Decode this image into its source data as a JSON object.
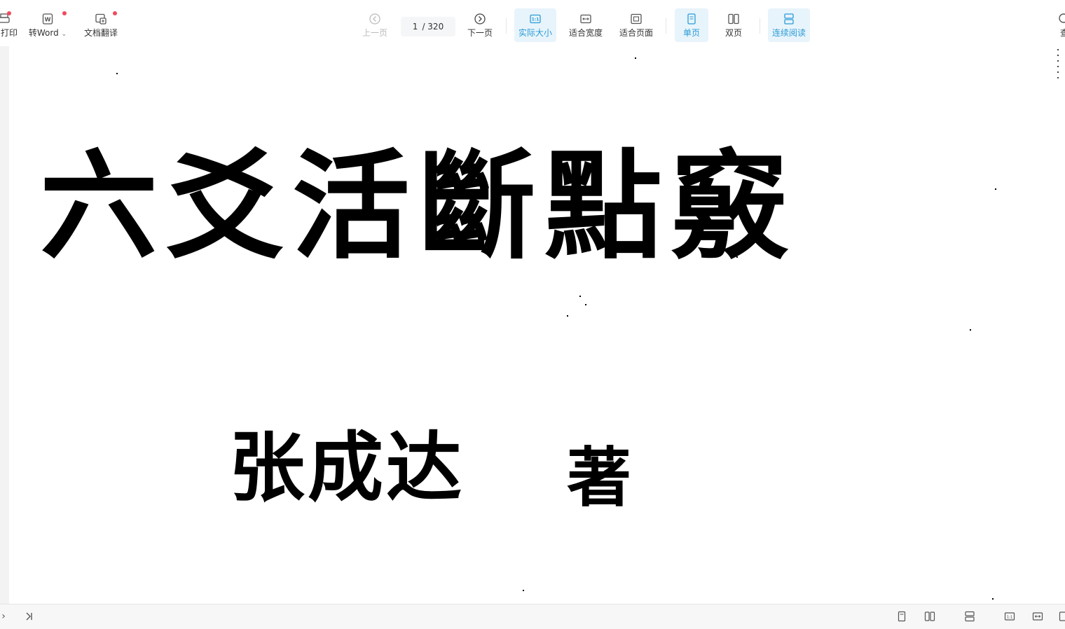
{
  "toolbar": {
    "print_label": "打印",
    "to_word_label": "转Word",
    "translate_label": "文档翻译",
    "prev_label": "上一页",
    "page_current": "1",
    "page_total": "/ 320",
    "next_label": "下一页",
    "actual_size_label": "实际大小",
    "fit_width_label": "适合宽度",
    "fit_page_label": "适合页面",
    "single_page_label": "单页",
    "double_page_label": "双页",
    "continuous_label": "连续阅读",
    "search_label": "查"
  },
  "document": {
    "title": "六爻活斷點竅",
    "author": "张成达",
    "author_suffix": "著"
  },
  "colors": {
    "accent": "#2a9bd8",
    "active_bg": "#e8f4fb",
    "badge": "#f04a5e"
  }
}
